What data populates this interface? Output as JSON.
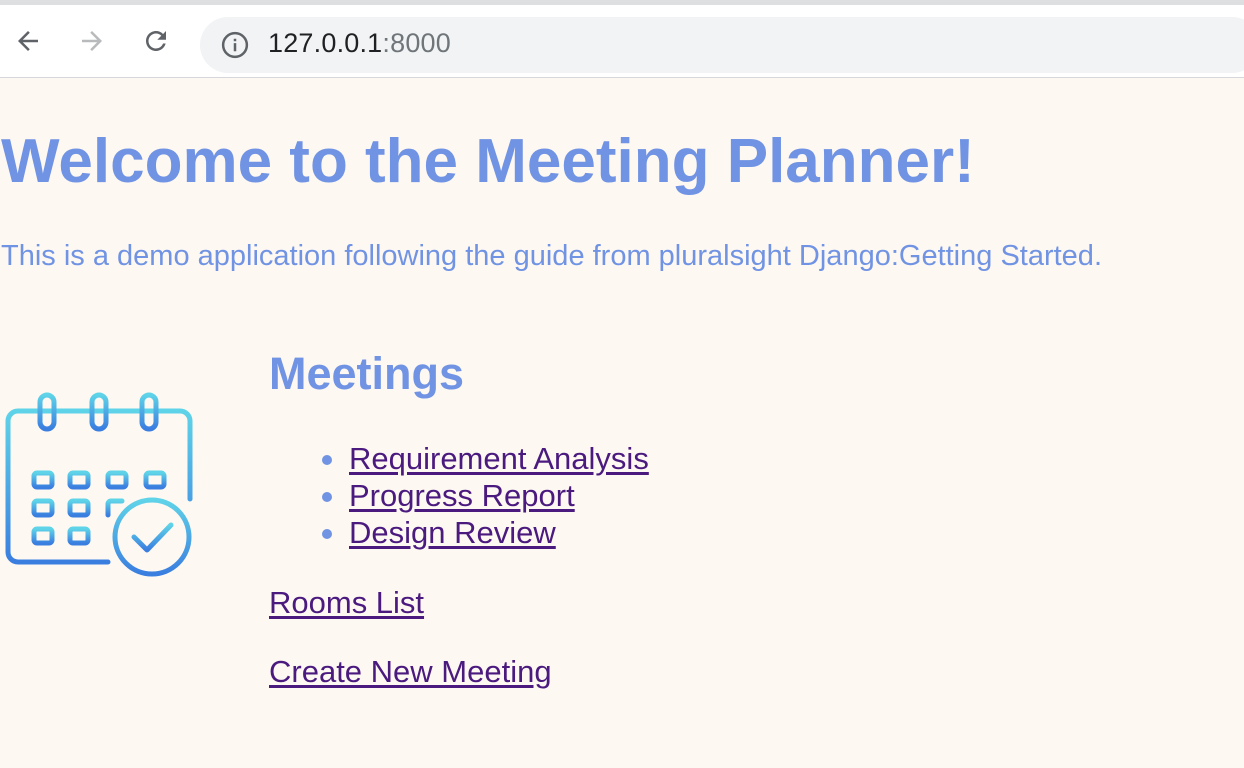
{
  "browser": {
    "url_host": "127.0.0.1",
    "url_port": ":8000",
    "icons": {
      "back": "arrow-left-icon",
      "forward": "arrow-right-icon",
      "reload": "reload-icon",
      "site_info": "info-icon"
    }
  },
  "page": {
    "title": "Welcome to the Meeting Planner!",
    "subtitle": "This is a demo application following the guide from pluralsight Django:Getting Started.",
    "section_heading": "Meetings",
    "meetings": [
      {
        "label": "Requirement Analysis"
      },
      {
        "label": "Progress Report"
      },
      {
        "label": "Design Review"
      }
    ],
    "rooms_link": "Rooms List",
    "create_link": "Create New Meeting",
    "icon": "calendar-check-icon"
  },
  "colors": {
    "accent": "#7093e3",
    "link": "#4b1a7f",
    "background": "#fdf8f2",
    "icon_gradient_top": "#5fd3e8",
    "icon_gradient_bottom": "#3a7ee0"
  }
}
